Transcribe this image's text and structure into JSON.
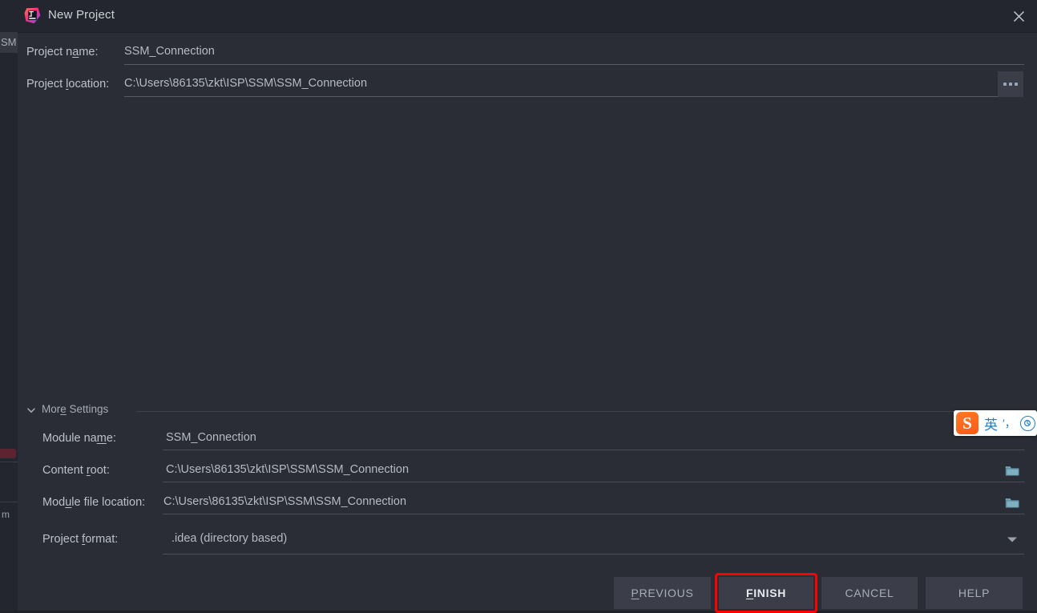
{
  "background": {
    "tool_tab_label": "SM",
    "left_fragment_label": "m"
  },
  "dialog": {
    "title": "New Project",
    "app_icon": "intellij-idea-icon",
    "close_icon": "close-icon",
    "top_form": {
      "project_name": {
        "label_pre": "Project n",
        "label_mn": "a",
        "label_post": "me:",
        "value": "SSM_Connection"
      },
      "project_location": {
        "label_pre": "Project ",
        "label_mn": "l",
        "label_post": "ocation:",
        "value": "C:\\Users\\86135\\zkt\\ISP\\SSM\\SSM_Connection",
        "browse_label": "..."
      }
    },
    "more_settings": {
      "label_pre": "Mor",
      "label_mn": "e",
      "label_post": " Settings",
      "expanded": true,
      "chevron_icon": "chevron-down-icon",
      "fields": [
        {
          "label_pre": "Module na",
          "label_mn": "m",
          "label_post": "e:",
          "value": "SSM_Connection",
          "trailing_icon": ""
        },
        {
          "label_pre": "Content ",
          "label_mn": "r",
          "label_post": "oot:",
          "value": "C:\\Users\\86135\\zkt\\ISP\\SSM\\SSM_Connection",
          "trailing_icon": "folder-icon"
        },
        {
          "label_pre": "Mod",
          "label_mn": "u",
          "label_post": "le file location:",
          "value": "C:\\Users\\86135\\zkt\\ISP\\SSM\\SSM_Connection",
          "trailing_icon": "folder-icon"
        },
        {
          "label_pre": "Project ",
          "label_mn": "f",
          "label_post": "ormat:",
          "value": ".idea (directory based)",
          "trailing_icon": "chevron-down-icon"
        }
      ]
    },
    "buttons": [
      {
        "pre": "",
        "mn": "P",
        "post": "REVIOUS",
        "name": "previous-button",
        "default": false,
        "highlighted": false
      },
      {
        "pre": "",
        "mn": "F",
        "post": "INISH",
        "name": "finish-button",
        "default": true,
        "highlighted": true
      },
      {
        "pre": "CANCEL",
        "mn": "",
        "post": "",
        "name": "cancel-button",
        "default": false,
        "highlighted": false
      },
      {
        "pre": "HELP",
        "mn": "",
        "post": "",
        "name": "help-button",
        "default": false,
        "highlighted": false
      }
    ],
    "highlight_color": "#ff0000"
  },
  "ime": {
    "logo_letter": "S",
    "mode_label": "英",
    "punct_icon": "′，",
    "extra_icon": "ⓢ"
  }
}
